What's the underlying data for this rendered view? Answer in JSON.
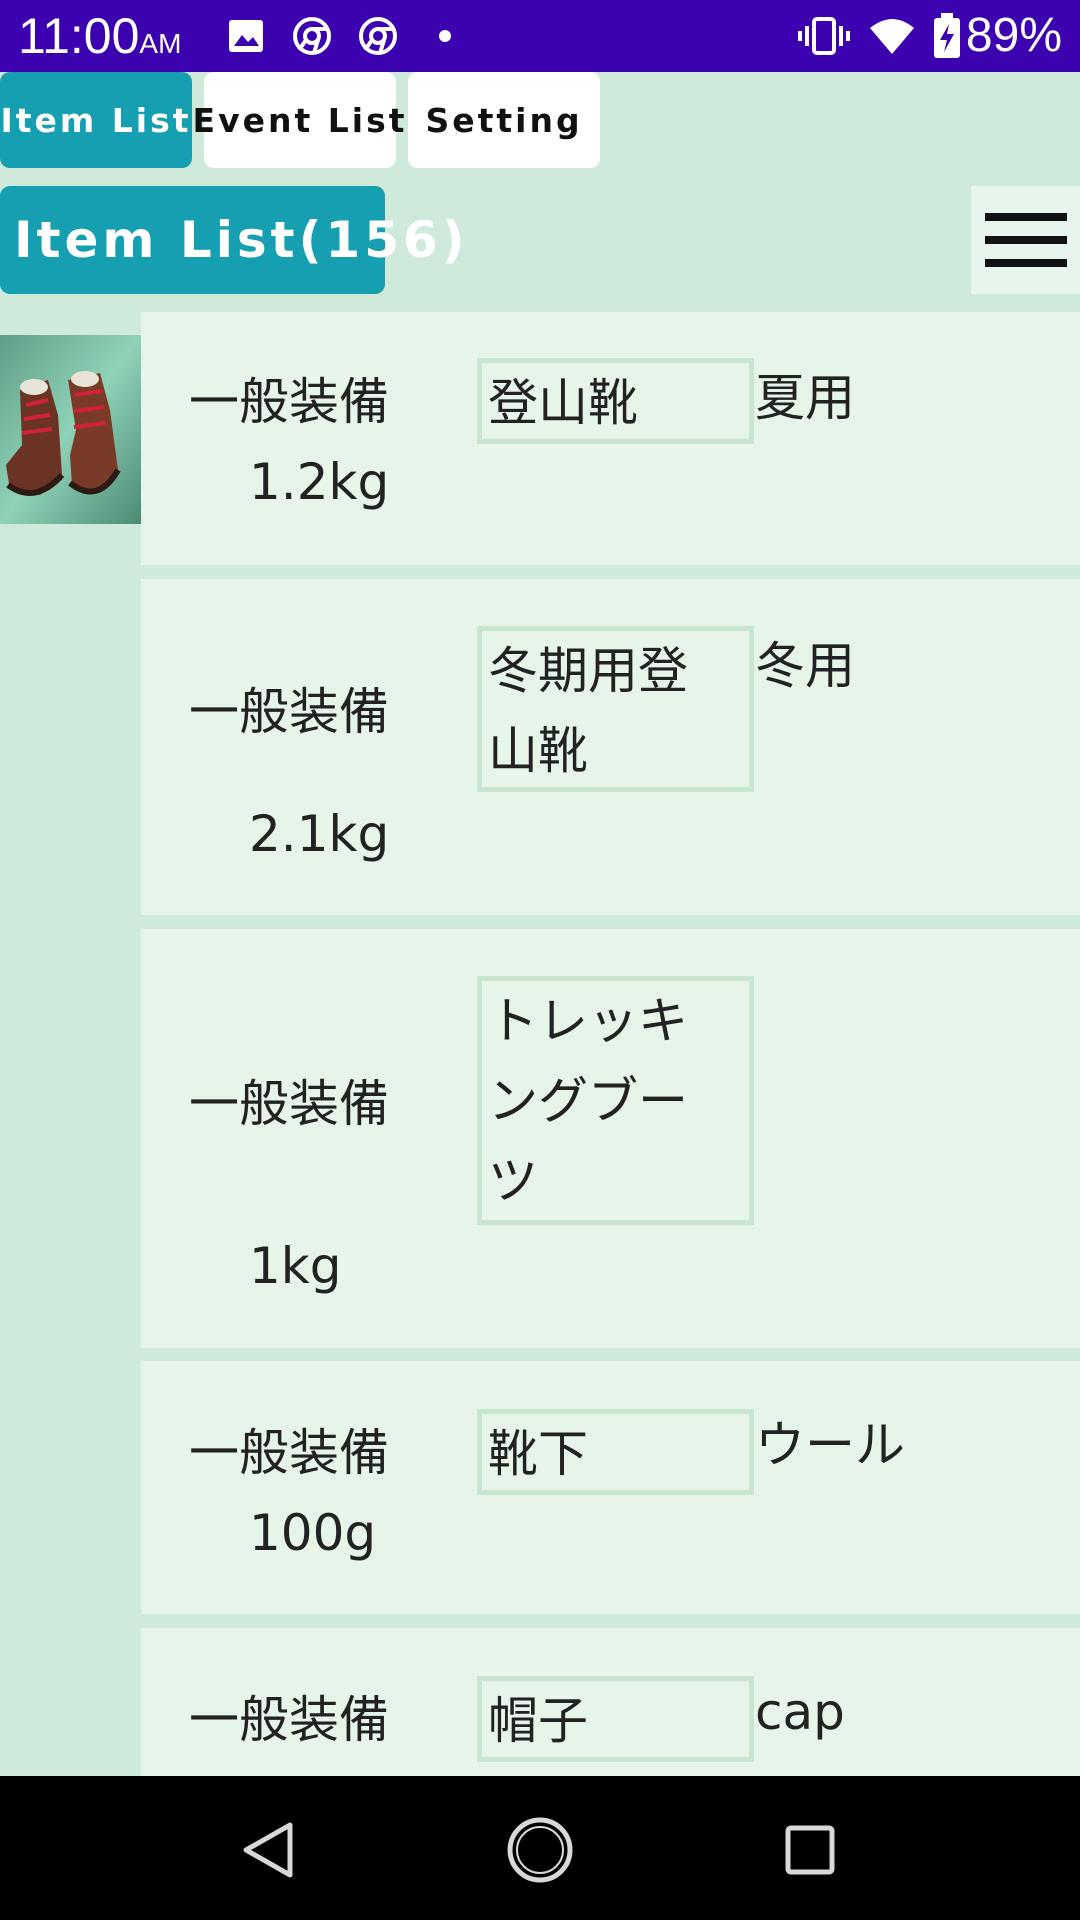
{
  "status_bar": {
    "time": "11:00",
    "ampm": "AM",
    "battery": "89%",
    "icons": [
      "image-icon",
      "chrome-icon",
      "chrome-icon",
      "dot-icon",
      "vibrate-icon",
      "wifi-icon",
      "battery-charging-icon"
    ]
  },
  "tabs": [
    {
      "label": "Item List",
      "active": true
    },
    {
      "label": "Event List",
      "active": false
    },
    {
      "label": "Setting",
      "active": false
    }
  ],
  "header": {
    "title": "Item List(156)",
    "menu_icon": "hamburger-menu-icon"
  },
  "items": [
    {
      "category": "一般装備",
      "weight": "1.2kg",
      "name": "登山靴",
      "note": "夏用",
      "has_image": true
    },
    {
      "category": "一般装備",
      "weight": "2.1kg",
      "name_lines": [
        "冬期用登",
        "山靴"
      ],
      "note": "冬用"
    },
    {
      "category": "一般装備",
      "weight": "1kg",
      "name_lines": [
        "トレッキ",
        "ングブー",
        "ツ"
      ],
      "note": ""
    },
    {
      "category": "一般装備",
      "weight": "100g",
      "name": "靴下",
      "note": "ウール"
    },
    {
      "category": "一般装備",
      "weight": "",
      "name": "帽子",
      "note": "cap"
    }
  ],
  "nav_bar": {
    "icons": [
      "back-icon",
      "home-icon",
      "recents-icon"
    ]
  },
  "colors": {
    "status_bar": "#3c02b0",
    "accent": "#169fb1",
    "background": "#cfe9da",
    "row": "#e6f4ea"
  }
}
